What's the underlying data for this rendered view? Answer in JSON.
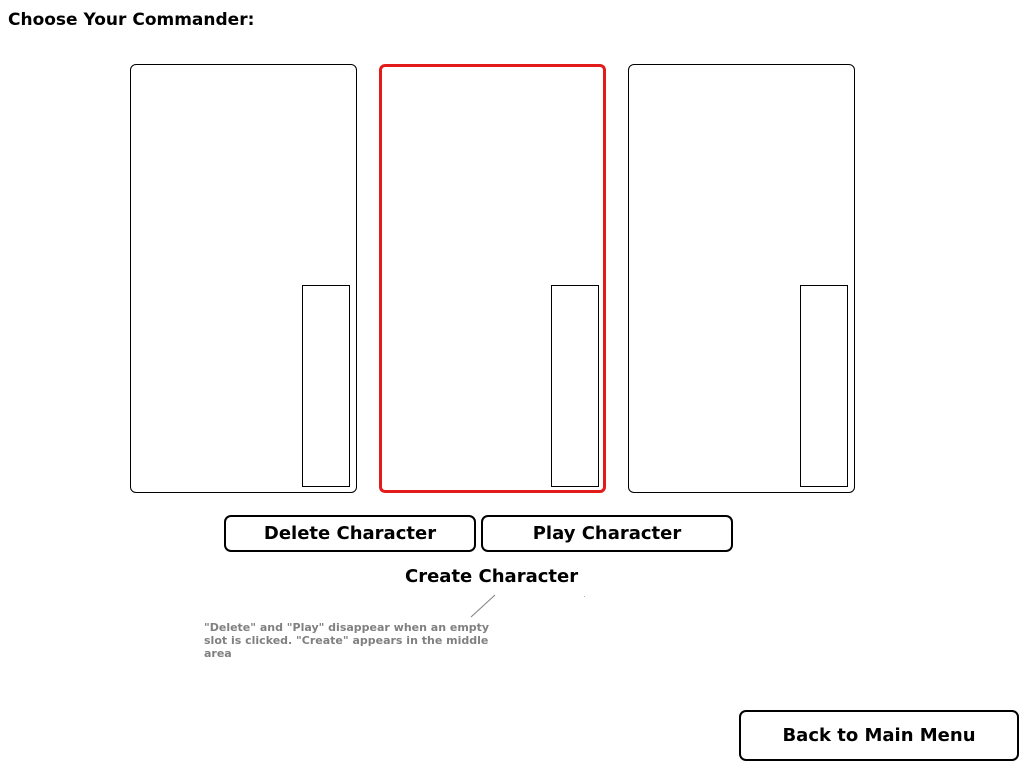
{
  "page": {
    "title": "Choose Your Commander:"
  },
  "slots": [
    {
      "id": 1,
      "selected": false
    },
    {
      "id": 2,
      "selected": true
    },
    {
      "id": 3,
      "selected": false
    }
  ],
  "actions": {
    "delete_label": "Delete Character",
    "play_label": "Play Character",
    "create_label": "Create Character"
  },
  "annotation": {
    "note": "\"Delete\" and \"Play\" disappear when an empty slot is clicked. \"Create\" appears in the middle area"
  },
  "footer": {
    "back_label": "Back to Main Menu"
  },
  "colors": {
    "selected_border": "#e31b1b",
    "note_text": "#808080"
  }
}
